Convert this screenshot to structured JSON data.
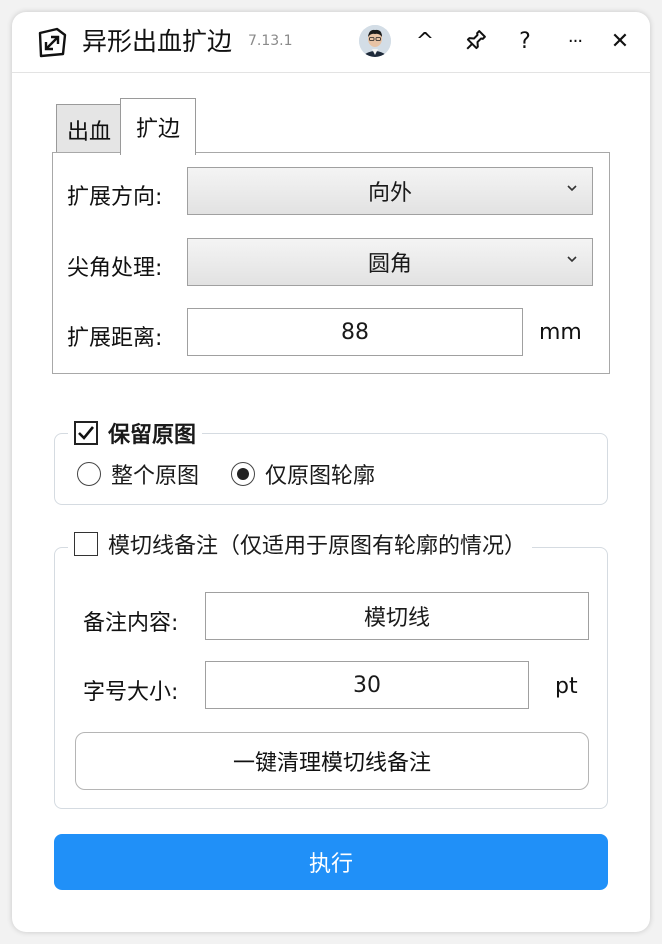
{
  "titlebar": {
    "title": "异形出血扩边",
    "version": "7.13.1",
    "collapse_glyph": "^",
    "help_glyph": "?",
    "more_glyph": "···",
    "close_glyph": "✕"
  },
  "tabs": [
    {
      "label": "出血",
      "active": false
    },
    {
      "label": "扩边",
      "active": true
    }
  ],
  "panel": {
    "direction_label": "扩展方向:",
    "direction_value": "向外",
    "corner_label": "尖角处理:",
    "corner_value": "圆角",
    "distance_label": "扩展距离:",
    "distance_value": "88",
    "distance_unit": "mm"
  },
  "keep_original": {
    "label": "保留原图",
    "checked": true,
    "options": [
      {
        "label": "整个原图",
        "selected": false
      },
      {
        "label": "仅原图轮廓",
        "selected": true
      }
    ]
  },
  "die_cut": {
    "label": "模切线备注（仅适用于原图有轮廓的情况）",
    "checked": false,
    "content_label": "备注内容:",
    "content_value": "模切线",
    "size_label": "字号大小:",
    "size_value": "30",
    "size_unit": "pt",
    "clear_button": "一键清理模切线备注"
  },
  "execute_button": "执行",
  "colors": {
    "primary": "#2090f8",
    "border": "#a0a0a0",
    "group_border": "#d5dbe1"
  }
}
